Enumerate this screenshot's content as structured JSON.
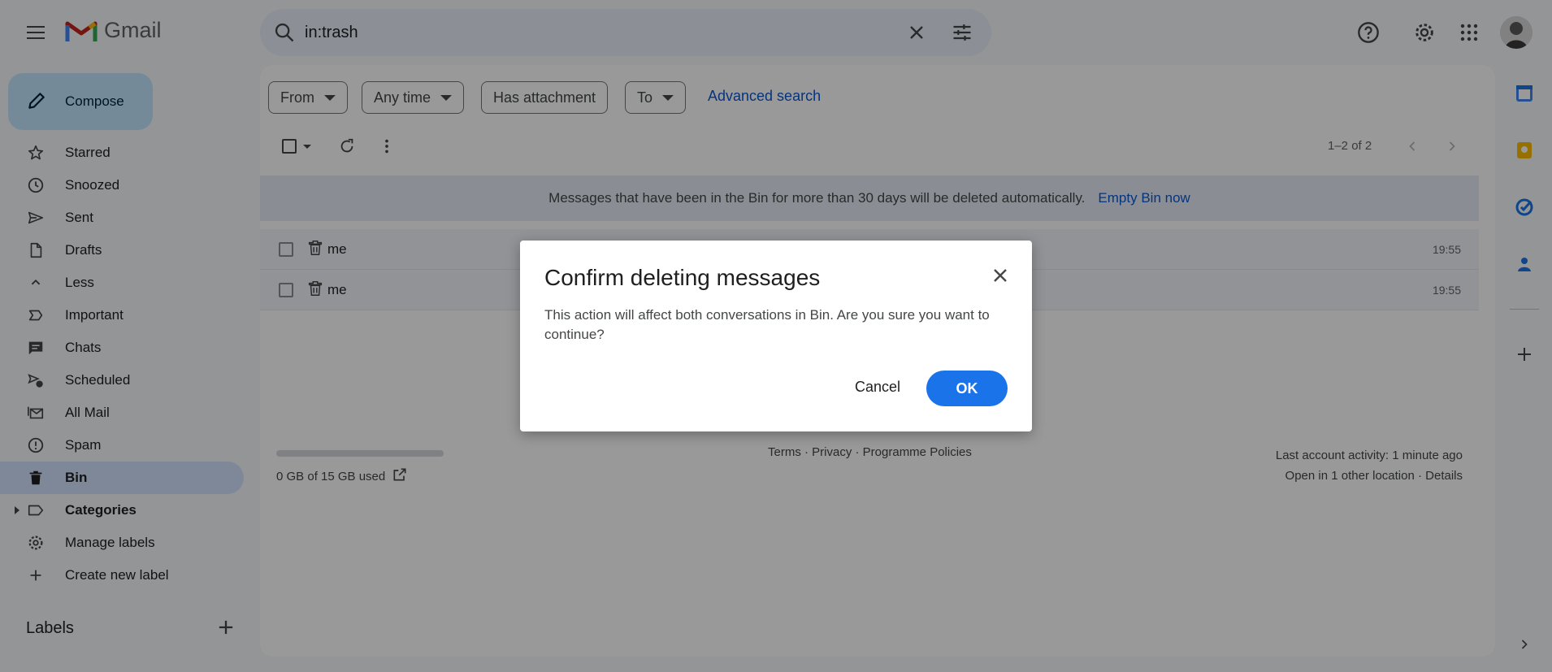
{
  "app": {
    "name": "Gmail"
  },
  "search": {
    "query": "in:trash"
  },
  "compose": {
    "label": "Compose"
  },
  "sidebar": {
    "items": [
      {
        "label": "Starred",
        "icon": "star-icon"
      },
      {
        "label": "Snoozed",
        "icon": "clock-icon"
      },
      {
        "label": "Sent",
        "icon": "send-icon"
      },
      {
        "label": "Drafts",
        "icon": "draft-icon"
      },
      {
        "label": "Less",
        "icon": "chevron-up-icon"
      },
      {
        "label": "Important",
        "icon": "important-icon"
      },
      {
        "label": "Chats",
        "icon": "chat-icon"
      },
      {
        "label": "Scheduled",
        "icon": "scheduled-icon"
      },
      {
        "label": "All Mail",
        "icon": "all-mail-icon"
      },
      {
        "label": "Spam",
        "icon": "spam-icon"
      },
      {
        "label": "Bin",
        "icon": "trash-icon",
        "active": true
      },
      {
        "label": "Categories",
        "icon": "label-icon"
      },
      {
        "label": "Manage labels",
        "icon": "gear-icon"
      },
      {
        "label": "Create new label",
        "icon": "plus-icon"
      }
    ],
    "labels_heading": "Labels"
  },
  "filters": {
    "from": "From",
    "any_time": "Any time",
    "has_attachment": "Has attachment",
    "to": "To",
    "advanced": "Advanced search"
  },
  "toolbar": {
    "page_count": "1–2 of 2"
  },
  "banner": {
    "text": "Messages that have been in the Bin for more than 30 days will be deleted automatically.",
    "action": "Empty Bin now"
  },
  "messages": [
    {
      "sender": "me",
      "time": "19:55"
    },
    {
      "sender": "me",
      "time": "19:55"
    }
  ],
  "footer": {
    "storage": "0 GB of 15 GB used",
    "links": "Terms · Privacy · Programme Policies",
    "activity": "Last account activity: 1 minute ago",
    "location": "Open in 1 other location · Details"
  },
  "dialog": {
    "title": "Confirm deleting messages",
    "body": "This action will affect both conversations in Bin. Are you sure you want to continue?",
    "cancel": "Cancel",
    "ok": "OK"
  },
  "colors": {
    "accent": "#1a73e8",
    "compose_bg": "#c2e7ff",
    "active_nav": "#d3e3fd",
    "link": "#0b57d0"
  }
}
